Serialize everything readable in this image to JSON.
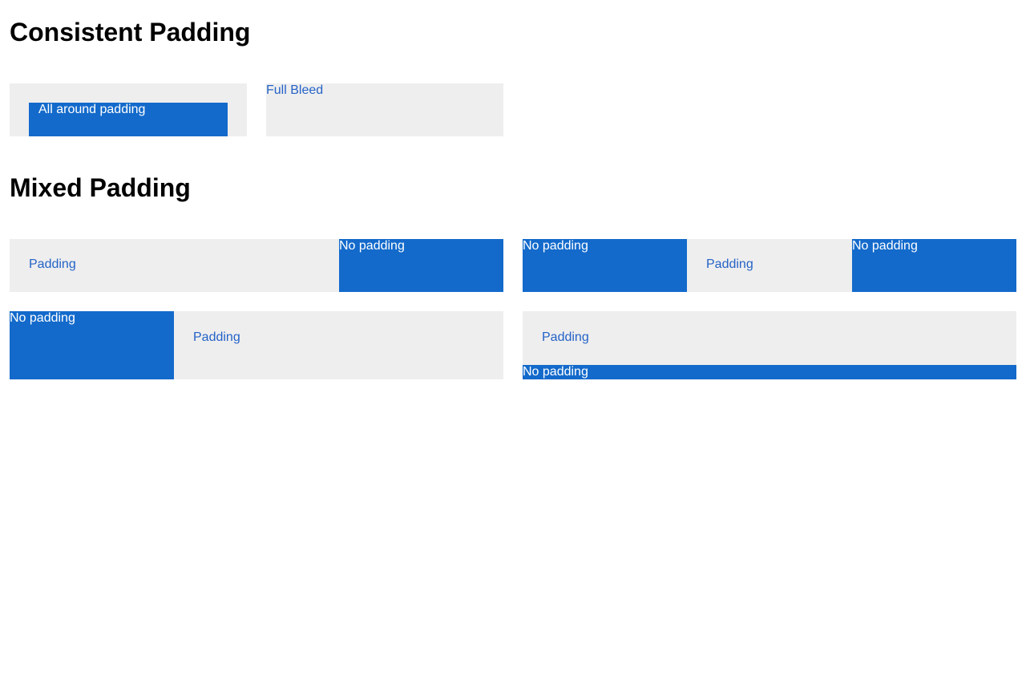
{
  "colors": {
    "grey_panel": "#eeeeee",
    "blue_panel": "#136acb",
    "link_text": "#2563c7",
    "heading": "#000000"
  },
  "sections": {
    "consistent": {
      "title": "Consistent Padding",
      "all_around_label": "All around padding",
      "full_bleed_label": "Full Bleed"
    },
    "mixed": {
      "title": "Mixed Padding",
      "row1_left": {
        "padding_label": "Padding",
        "no_padding_label": "No padding"
      },
      "row1_right": {
        "no_padding_left_label": "No padding",
        "padding_label": "Padding",
        "no_padding_right_label": "No padding"
      },
      "row2_left": {
        "no_padding_label": "No padding",
        "padding_label": "Padding"
      },
      "row2_right": {
        "padding_label": "Padding",
        "no_padding_label": "No padding"
      }
    }
  }
}
